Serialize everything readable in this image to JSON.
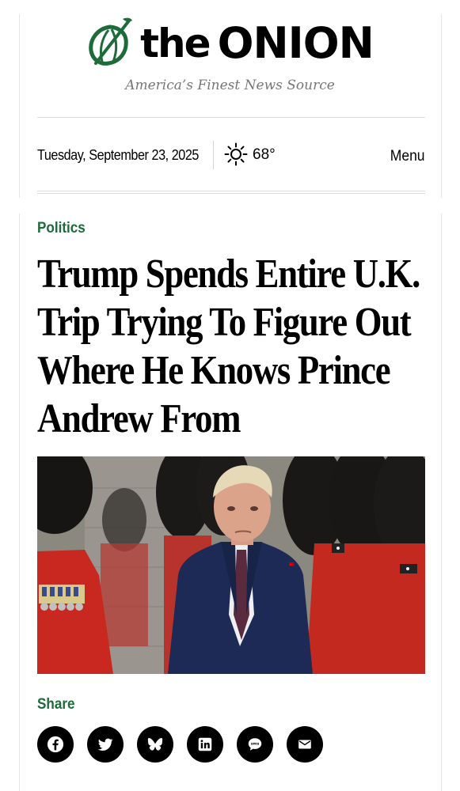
{
  "header": {
    "logo_text_the": "the",
    "logo_text_onion": "ONION",
    "tagline": "America’s Finest News Source",
    "brand_color": "#1e6b3a"
  },
  "datebar": {
    "date": "Tuesday, September 23, 2025",
    "weather_icon": "sun-icon",
    "temperature": "68°",
    "menu_label": "Menu"
  },
  "article": {
    "category": "Politics",
    "headline": "Trump Spends Entire U.K. Trip Trying To Figure Out Where He Knows Prince Andrew From",
    "share_label": "Share",
    "share_buttons": [
      {
        "icon": "facebook-icon"
      },
      {
        "icon": "twitter-icon"
      },
      {
        "icon": "bluesky-icon"
      },
      {
        "icon": "linkedin-icon"
      },
      {
        "icon": "sms-icon",
        "label": "sms"
      },
      {
        "icon": "email-icon"
      }
    ]
  }
}
